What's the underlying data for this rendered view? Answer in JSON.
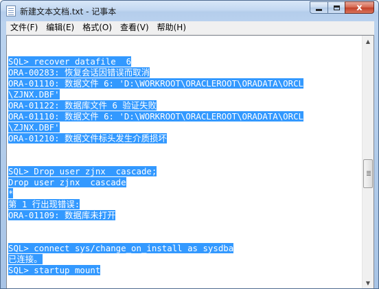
{
  "window": {
    "title": "新建文本文档.txt - 记事本",
    "close_label": "x"
  },
  "menu": {
    "items": [
      {
        "label": "文件(F)"
      },
      {
        "label": "编辑(E)"
      },
      {
        "label": "格式(O)"
      },
      {
        "label": "查看(V)"
      },
      {
        "label": "帮助(H)"
      }
    ]
  },
  "editor": {
    "selection_color": "#3399ff",
    "lines": [
      "SQL> recover datafile  6",
      "ORA-00283: 恢复会话因错误而取消",
      "ORA-01110: 数据文件 6: 'D:\\WORKROOT\\ORACLEROOT\\ORADATA\\ORCL",
      "\\ZJNX.DBF'",
      "ORA-01122: 数据库文件 6 验证失败",
      "ORA-01110: 数据文件 6: 'D:\\WORKROOT\\ORACLEROOT\\ORADATA\\ORCL",
      "\\ZJNX.DBF'",
      "ORA-01210: 数据文件标头发生介质损坏",
      "",
      "",
      "SQL> Drop user zjnx  cascade;",
      "Drop user zjnx  cascade",
      "*",
      "第 1 行出现错误:",
      "ORA-01109: 数据库未打开",
      "",
      "",
      "SQL> connect sys/change_on_install as sysdba",
      "已连接。",
      "SQL> startup mount"
    ]
  }
}
